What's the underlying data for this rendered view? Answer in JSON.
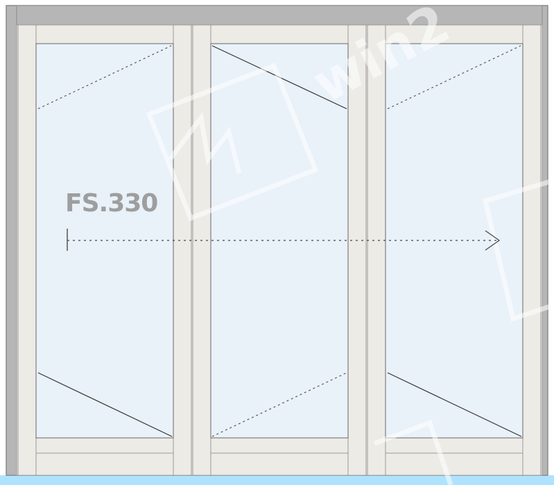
{
  "diagram": {
    "model_label": "FS.330",
    "panel_count": 3,
    "opening_direction": "right",
    "colors": {
      "outer_frame": "#b6b6b6",
      "outer_frame_edge": "#8a8a8a",
      "sash_frame": "#ecebe6",
      "glass": "#e9f1f9",
      "lines": "#3a3a3a",
      "floor_track": "#aee3ff",
      "watermark": "#ffffff"
    },
    "panels": [
      {
        "name": "left-panel",
        "top_hinge_line": "dashed",
        "bottom_hinge_line": "solid"
      },
      {
        "name": "middle-panel",
        "top_hinge_line": "solid",
        "bottom_hinge_line": "dashed"
      },
      {
        "name": "right-panel",
        "top_hinge_line": "dashed",
        "bottom_hinge_line": "solid"
      }
    ]
  }
}
